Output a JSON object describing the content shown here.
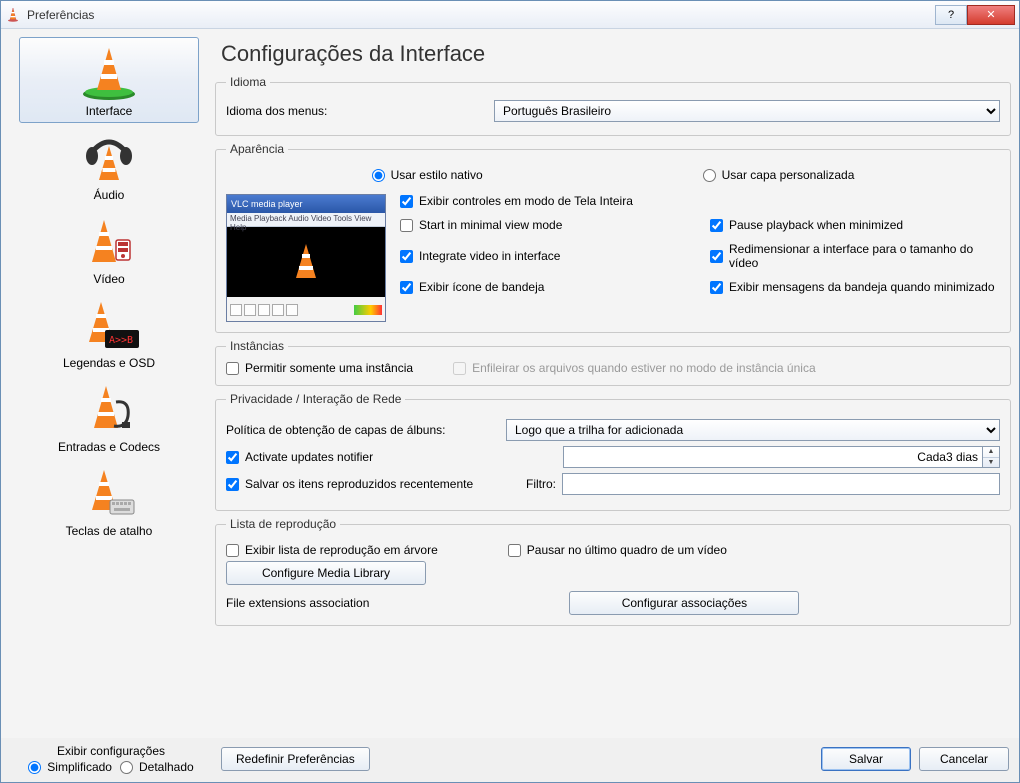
{
  "window": {
    "title": "Preferências"
  },
  "titlebar": {
    "help": "?",
    "close": "✕"
  },
  "sidebar": {
    "items": [
      {
        "label": "Interface"
      },
      {
        "label": "Áudio"
      },
      {
        "label": "Vídeo"
      },
      {
        "label": "Legendas e OSD"
      },
      {
        "label": "Entradas e Codecs"
      },
      {
        "label": "Teclas de atalho"
      }
    ]
  },
  "page": {
    "title": "Configurações da Interface"
  },
  "groups": {
    "idioma": {
      "legend": "Idioma",
      "menus_label": "Idioma dos menus:",
      "menus_value": "Português Brasileiro"
    },
    "aparencia": {
      "legend": "Aparência",
      "native": "Usar estilo nativo",
      "custom": "Usar capa personalizada",
      "preview_title": "VLC media player",
      "preview_menu": "Media  Playback  Audio  Video  Tools  View  Help",
      "checks": {
        "fullscreen": "Exibir controles em modo de Tela Inteira",
        "minimal": "Start in minimal view mode",
        "pause_min": "Pause playback when minimized",
        "integrate": "Integrate video in interface",
        "resize": "Redimensionar a interface para o tamanho do vídeo",
        "tray": "Exibir ícone de bandeja",
        "tray_msg": "Exibir mensagens da bandeja quando minimizado"
      }
    },
    "instancias": {
      "legend": "Instâncias",
      "single": "Permitir somente uma instância",
      "enqueue": "Enfileirar os arquivos quando estiver no modo de instância única"
    },
    "privacidade": {
      "legend": "Privacidade / Interação de Rede",
      "policy_label": "Política de obtenção de capas de álbuns:",
      "policy_value": "Logo que a trilha for adicionada",
      "updates": "Activate updates notifier",
      "updates_every": "Cada3 dias",
      "save_recent": "Salvar os itens reproduzidos recentemente",
      "filter_label": "Filtro:",
      "filter_value": ""
    },
    "playlist": {
      "legend": "Lista de reprodução",
      "tree": "Exibir lista de reprodução em árvore",
      "pause_last": "Pausar no último quadro de um vídeo",
      "config_lib": "Configure Media Library",
      "ext_label": "File extensions association",
      "ext_btn": "Configurar associações"
    }
  },
  "footer": {
    "show_label": "Exibir configurações",
    "simple": "Simplificado",
    "detailed": "Detalhado",
    "reset": "Redefinir Preferências",
    "save": "Salvar",
    "cancel": "Cancelar"
  }
}
